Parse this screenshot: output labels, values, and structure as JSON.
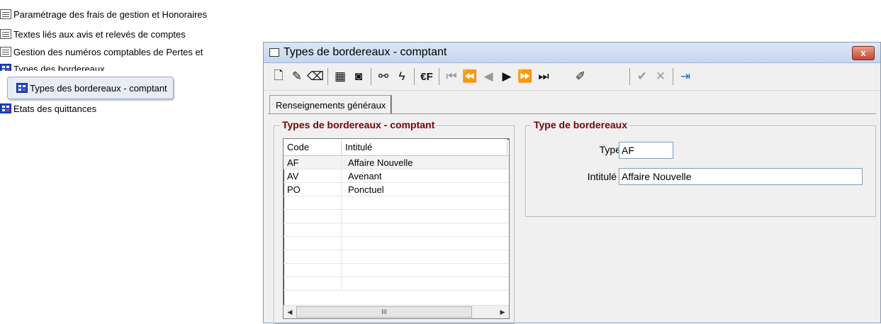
{
  "tree": {
    "items": [
      {
        "label": "Paramétrage des frais de gestion et Honoraires",
        "icon": "list-icon"
      },
      {
        "label": "Textes liés aux avis et relevés de comptes",
        "icon": "list-icon"
      },
      {
        "label": "Gestion des numéros comptables de Pertes et",
        "icon": "list-icon"
      },
      {
        "label": "Types des bordereaux",
        "icon": "grid-icon"
      },
      {
        "label": "Types des bordereaux - comptant",
        "icon": "grid-icon"
      },
      {
        "label": "Etats des quittances",
        "icon": "grid-icon"
      }
    ]
  },
  "window": {
    "title": "Types de bordereaux - comptant",
    "close_label": "x"
  },
  "toolbar": {
    "euro_label": "€F"
  },
  "tab": {
    "label": "Renseignements généraux"
  },
  "list_group": {
    "legend": "Types de bordereaux - comptant",
    "columns": [
      "Code",
      "Intitulé"
    ],
    "rows": [
      {
        "code": "AF",
        "intitule": "Affaire Nouvelle"
      },
      {
        "code": "AV",
        "intitule": "Avenant"
      },
      {
        "code": "PO",
        "intitule": "Ponctuel"
      }
    ],
    "scroll_thumb": "III"
  },
  "detail_group": {
    "legend": "Type de bordereaux",
    "type_label": "Type",
    "type_value": "AF",
    "intitule_label": "Intitulé",
    "intitule_value": "Affaire Nouvelle"
  },
  "colors": {
    "legend": "#7a0000",
    "title_bar": "#c5d6ee",
    "close": "#c5442c"
  }
}
